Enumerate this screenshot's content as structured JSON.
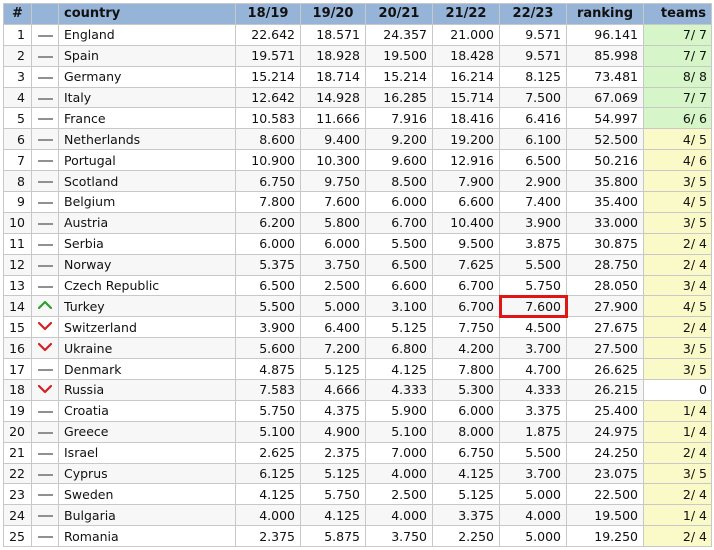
{
  "headers": [
    "#",
    "",
    "country",
    "18/19",
    "19/20",
    "20/21",
    "21/22",
    "22/23",
    "ranking",
    "teams"
  ],
  "rows": [
    {
      "n": "1",
      "trend": "same",
      "country": "England",
      "y1": "22.642",
      "y2": "18.571",
      "y3": "24.357",
      "y4": "21.000",
      "y5": "9.571",
      "ranking": "96.141",
      "teams": "7/ 7",
      "teams_bg": "green"
    },
    {
      "n": "2",
      "trend": "same",
      "country": "Spain",
      "y1": "19.571",
      "y2": "18.928",
      "y3": "19.500",
      "y4": "18.428",
      "y5": "9.571",
      "ranking": "85.998",
      "teams": "7/ 7",
      "teams_bg": "green"
    },
    {
      "n": "3",
      "trend": "same",
      "country": "Germany",
      "y1": "15.214",
      "y2": "18.714",
      "y3": "15.214",
      "y4": "16.214",
      "y5": "8.125",
      "ranking": "73.481",
      "teams": "8/ 8",
      "teams_bg": "green"
    },
    {
      "n": "4",
      "trend": "same",
      "country": "Italy",
      "y1": "12.642",
      "y2": "14.928",
      "y3": "16.285",
      "y4": "15.714",
      "y5": "7.500",
      "ranking": "67.069",
      "teams": "7/ 7",
      "teams_bg": "green"
    },
    {
      "n": "5",
      "trend": "same",
      "country": "France",
      "y1": "10.583",
      "y2": "11.666",
      "y3": "7.916",
      "y4": "18.416",
      "y5": "6.416",
      "ranking": "54.997",
      "teams": "6/ 6",
      "teams_bg": "green"
    },
    {
      "n": "6",
      "trend": "same",
      "country": "Netherlands",
      "y1": "8.600",
      "y2": "9.400",
      "y3": "9.200",
      "y4": "19.200",
      "y5": "6.100",
      "ranking": "52.500",
      "teams": "4/ 5",
      "teams_bg": "yellow"
    },
    {
      "n": "7",
      "trend": "same",
      "country": "Portugal",
      "y1": "10.900",
      "y2": "10.300",
      "y3": "9.600",
      "y4": "12.916",
      "y5": "6.500",
      "ranking": "50.216",
      "teams": "4/ 6",
      "teams_bg": "yellow"
    },
    {
      "n": "8",
      "trend": "same",
      "country": "Scotland",
      "y1": "6.750",
      "y2": "9.750",
      "y3": "8.500",
      "y4": "7.900",
      "y5": "2.900",
      "ranking": "35.800",
      "teams": "3/ 5",
      "teams_bg": "yellow"
    },
    {
      "n": "9",
      "trend": "same",
      "country": "Belgium",
      "y1": "7.800",
      "y2": "7.600",
      "y3": "6.000",
      "y4": "6.600",
      "y5": "7.400",
      "ranking": "35.400",
      "teams": "4/ 5",
      "teams_bg": "yellow"
    },
    {
      "n": "10",
      "trend": "same",
      "country": "Austria",
      "y1": "6.200",
      "y2": "5.800",
      "y3": "6.700",
      "y4": "10.400",
      "y5": "3.900",
      "ranking": "33.000",
      "teams": "3/ 5",
      "teams_bg": "yellow"
    },
    {
      "n": "11",
      "trend": "same",
      "country": "Serbia",
      "y1": "6.000",
      "y2": "6.000",
      "y3": "5.500",
      "y4": "9.500",
      "y5": "3.875",
      "ranking": "30.875",
      "teams": "2/ 4",
      "teams_bg": "yellow"
    },
    {
      "n": "12",
      "trend": "same",
      "country": "Norway",
      "y1": "5.375",
      "y2": "3.750",
      "y3": "6.500",
      "y4": "7.625",
      "y5": "5.500",
      "ranking": "28.750",
      "teams": "2/ 4",
      "teams_bg": "yellow"
    },
    {
      "n": "13",
      "trend": "same",
      "country": "Czech Republic",
      "y1": "6.500",
      "y2": "2.500",
      "y3": "6.600",
      "y4": "6.700",
      "y5": "5.750",
      "ranking": "28.050",
      "teams": "3/ 4",
      "teams_bg": "yellow"
    },
    {
      "n": "14",
      "trend": "up",
      "country": "Turkey",
      "y1": "5.500",
      "y2": "5.000",
      "y3": "3.100",
      "y4": "6.700",
      "y5": "7.600",
      "ranking": "27.900",
      "teams": "4/ 5",
      "teams_bg": "yellow",
      "highlight": true
    },
    {
      "n": "15",
      "trend": "down",
      "country": "Switzerland",
      "y1": "3.900",
      "y2": "6.400",
      "y3": "5.125",
      "y4": "7.750",
      "y5": "4.500",
      "ranking": "27.675",
      "teams": "2/ 4",
      "teams_bg": "yellow"
    },
    {
      "n": "16",
      "trend": "down",
      "country": "Ukraine",
      "y1": "5.600",
      "y2": "7.200",
      "y3": "6.800",
      "y4": "4.200",
      "y5": "3.700",
      "ranking": "27.500",
      "teams": "3/ 5",
      "teams_bg": "yellow"
    },
    {
      "n": "17",
      "trend": "same",
      "country": "Denmark",
      "y1": "4.875",
      "y2": "5.125",
      "y3": "4.125",
      "y4": "7.800",
      "y5": "4.700",
      "ranking": "26.625",
      "teams": "3/ 5",
      "teams_bg": "yellow"
    },
    {
      "n": "18",
      "trend": "down",
      "country": "Russia",
      "y1": "7.583",
      "y2": "4.666",
      "y3": "4.333",
      "y4": "5.300",
      "y5": "4.333",
      "ranking": "26.215",
      "teams": "0",
      "teams_bg": "white"
    },
    {
      "n": "19",
      "trend": "same",
      "country": "Croatia",
      "y1": "5.750",
      "y2": "4.375",
      "y3": "5.900",
      "y4": "6.000",
      "y5": "3.375",
      "ranking": "25.400",
      "teams": "1/ 4",
      "teams_bg": "yellow"
    },
    {
      "n": "20",
      "trend": "same",
      "country": "Greece",
      "y1": "5.100",
      "y2": "4.900",
      "y3": "5.100",
      "y4": "8.000",
      "y5": "1.875",
      "ranking": "24.975",
      "teams": "1/ 4",
      "teams_bg": "yellow"
    },
    {
      "n": "21",
      "trend": "same",
      "country": "Israel",
      "y1": "2.625",
      "y2": "2.375",
      "y3": "7.000",
      "y4": "6.750",
      "y5": "5.500",
      "ranking": "24.250",
      "teams": "2/ 4",
      "teams_bg": "yellow"
    },
    {
      "n": "22",
      "trend": "same",
      "country": "Cyprus",
      "y1": "6.125",
      "y2": "5.125",
      "y3": "4.000",
      "y4": "4.125",
      "y5": "3.700",
      "ranking": "23.075",
      "teams": "3/ 5",
      "teams_bg": "yellow"
    },
    {
      "n": "23",
      "trend": "same",
      "country": "Sweden",
      "y1": "4.125",
      "y2": "5.750",
      "y3": "2.500",
      "y4": "5.125",
      "y5": "5.000",
      "ranking": "22.500",
      "teams": "2/ 4",
      "teams_bg": "yellow"
    },
    {
      "n": "24",
      "trend": "same",
      "country": "Bulgaria",
      "y1": "4.000",
      "y2": "4.125",
      "y3": "4.000",
      "y4": "3.375",
      "y5": "4.000",
      "ranking": "19.500",
      "teams": "1/ 4",
      "teams_bg": "yellow"
    },
    {
      "n": "25",
      "trend": "same",
      "country": "Romania",
      "y1": "2.375",
      "y2": "5.875",
      "y3": "3.750",
      "y4": "2.250",
      "y5": "5.000",
      "ranking": "19.250",
      "teams": "2/ 4",
      "teams_bg": "yellow"
    }
  ],
  "colors": {
    "header_bg": "#96b4d7",
    "teams_green": "#d6f5c8",
    "teams_yellow": "#fafac8",
    "trend_up": "#2e9e2e",
    "trend_down": "#d42020",
    "highlight_border": "#e01515"
  },
  "trend_icons": {
    "same": "dash-icon",
    "up": "arrow-up-icon",
    "down": "arrow-down-icon"
  }
}
